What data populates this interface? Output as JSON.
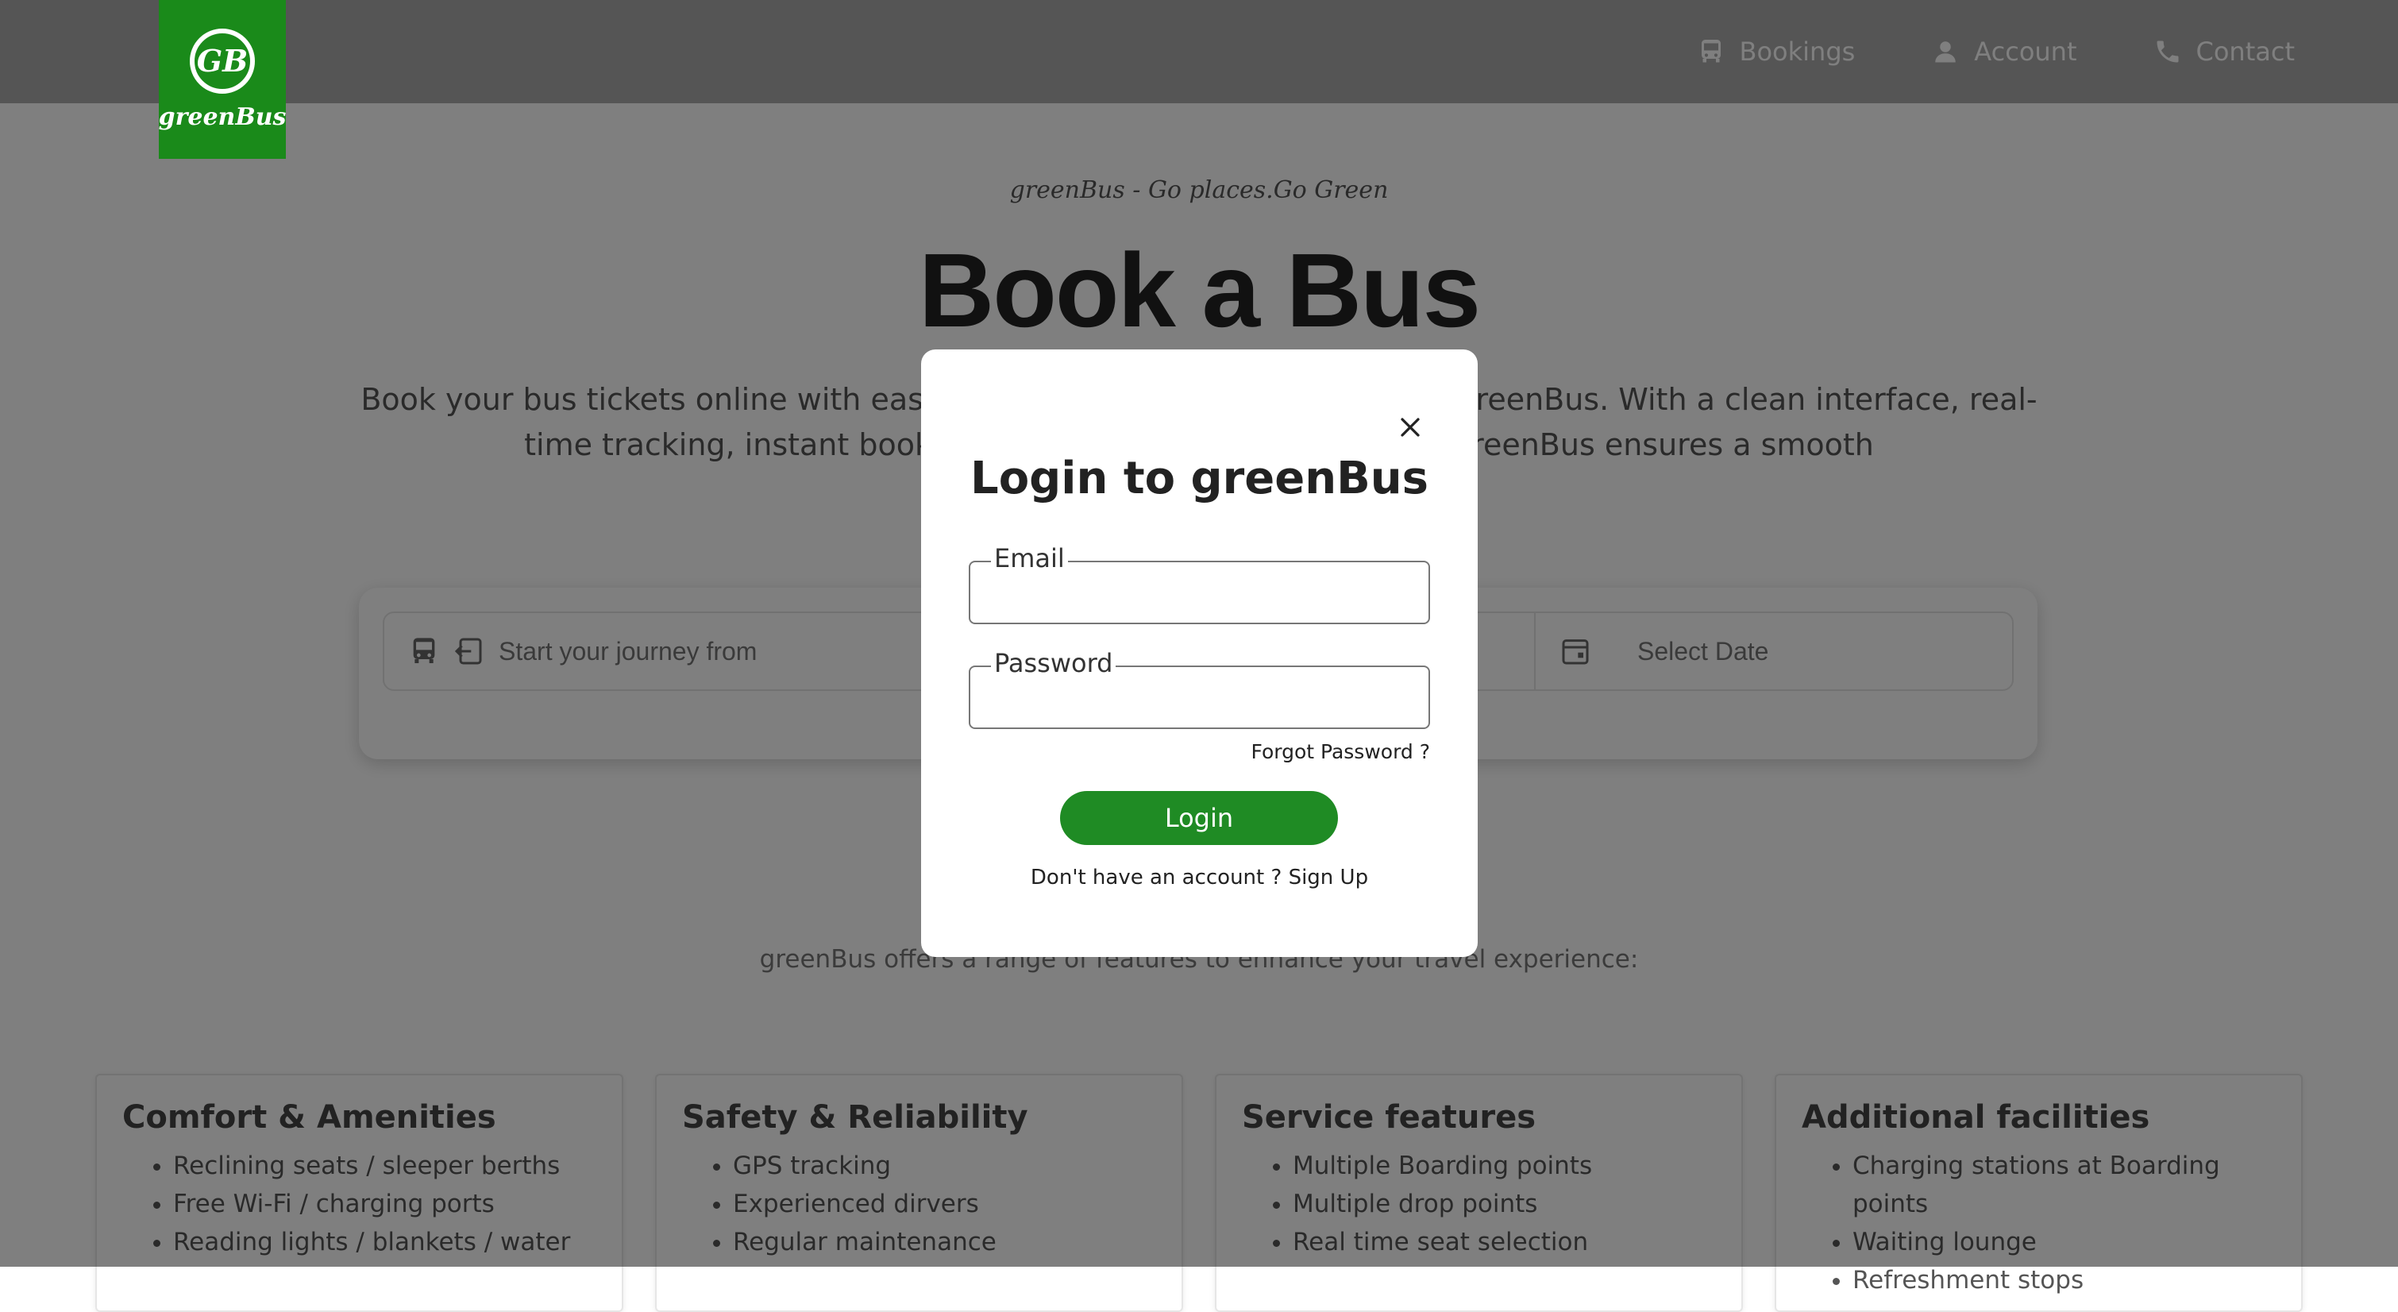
{
  "brand": {
    "logo_initials": "GB",
    "logo_text": "greenBus"
  },
  "nav": {
    "items": [
      {
        "label": "Bookings",
        "icon": "bus-icon"
      },
      {
        "label": "Account",
        "icon": "user-icon"
      },
      {
        "label": "Contact",
        "icon": "phone-icon"
      }
    ]
  },
  "hero": {
    "tagline": "greenBus - Go places.Go Green",
    "title": "Book a Bus",
    "description": "Book your bus tickets online with ease and enjoy hassle-free travel with greenBus. With a clean interface, real-time tracking, instant booking and flexible payment options, GreenBus ensures a smooth"
  },
  "search": {
    "from_placeholder": "Start your journey from",
    "date_placeholder": "Select Date"
  },
  "features": {
    "intro": "greenBus offers a range of features to enhance your travel experience:",
    "cards": [
      {
        "title": "Comfort & Amenities",
        "items": [
          "Reclining seats / sleeper berths",
          "Free Wi-Fi / charging ports",
          "Reading lights / blankets / water"
        ]
      },
      {
        "title": "Safety & Reliability",
        "items": [
          "GPS tracking",
          "Experienced dirvers",
          "Regular maintenance"
        ]
      },
      {
        "title": "Service features",
        "items": [
          "Multiple Boarding points",
          "Multiple drop points",
          "Real time seat selection"
        ]
      },
      {
        "title": "Additional facilities",
        "items": [
          "Charging stations at Boarding points",
          "Waiting lounge",
          "Refreshment stops"
        ]
      }
    ]
  },
  "modal": {
    "title": "Login to greenBus",
    "email_label": "Email",
    "email_value": "",
    "password_label": "Password",
    "password_value": "",
    "forgot": "Forgot Password ?",
    "login": "Login",
    "signup_prompt": "Don't have an account ?",
    "signup_link": "Sign Up"
  },
  "colors": {
    "brand_green": "#1a8a1a",
    "button_green": "#1f8b24",
    "overlay": "rgba(0,0,0,0.5)"
  }
}
